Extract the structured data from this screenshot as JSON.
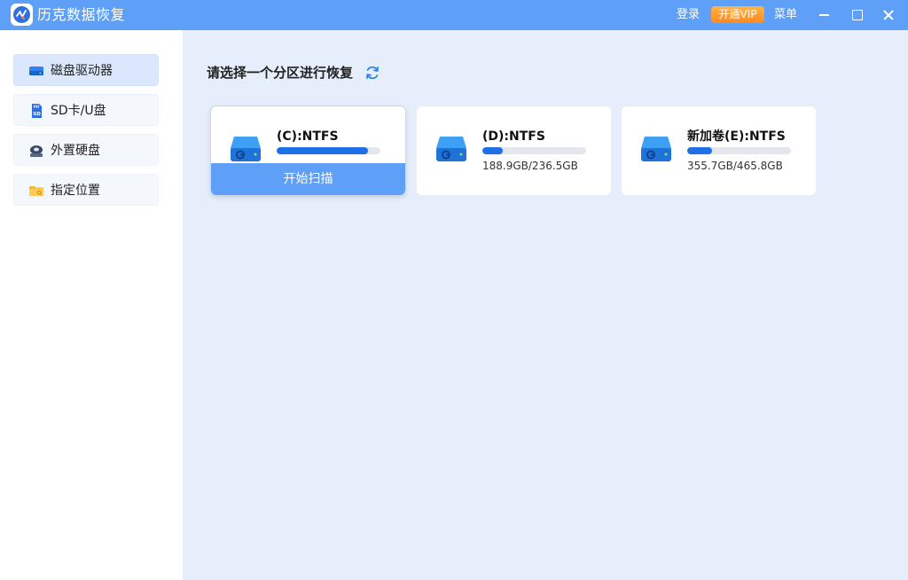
{
  "app": {
    "title": "历克数据恢复"
  },
  "titlebar": {
    "login": "登录",
    "vip": "开通VIP",
    "menu": "菜单"
  },
  "sidebar": {
    "items": [
      {
        "label": "磁盘驱动器",
        "icon": "hard-drive-icon",
        "active": true
      },
      {
        "label": "SD卡/U盘",
        "icon": "sd-card-icon",
        "active": false
      },
      {
        "label": "外置硬盘",
        "icon": "external-drive-icon",
        "active": false
      },
      {
        "label": "指定位置",
        "icon": "folder-icon",
        "active": false
      }
    ]
  },
  "main": {
    "title": "请选择一个分区进行恢复",
    "partitions": [
      {
        "name": "(C):NTFS",
        "usage": 0.88,
        "size": "",
        "scan_label": "开始扫描",
        "selected": true
      },
      {
        "name": "(D):NTFS",
        "usage": 0.2,
        "size": "188.9GB/236.5GB",
        "selected": false
      },
      {
        "name": "新加卷(E):NTFS",
        "usage": 0.24,
        "size": "355.7GB/465.8GB",
        "selected": false
      }
    ]
  },
  "colors": {
    "accent": "#5e9ff7",
    "bar_fill": "#1f6fe6",
    "vip": "#ff9a2a",
    "background": "#e6eefb"
  }
}
